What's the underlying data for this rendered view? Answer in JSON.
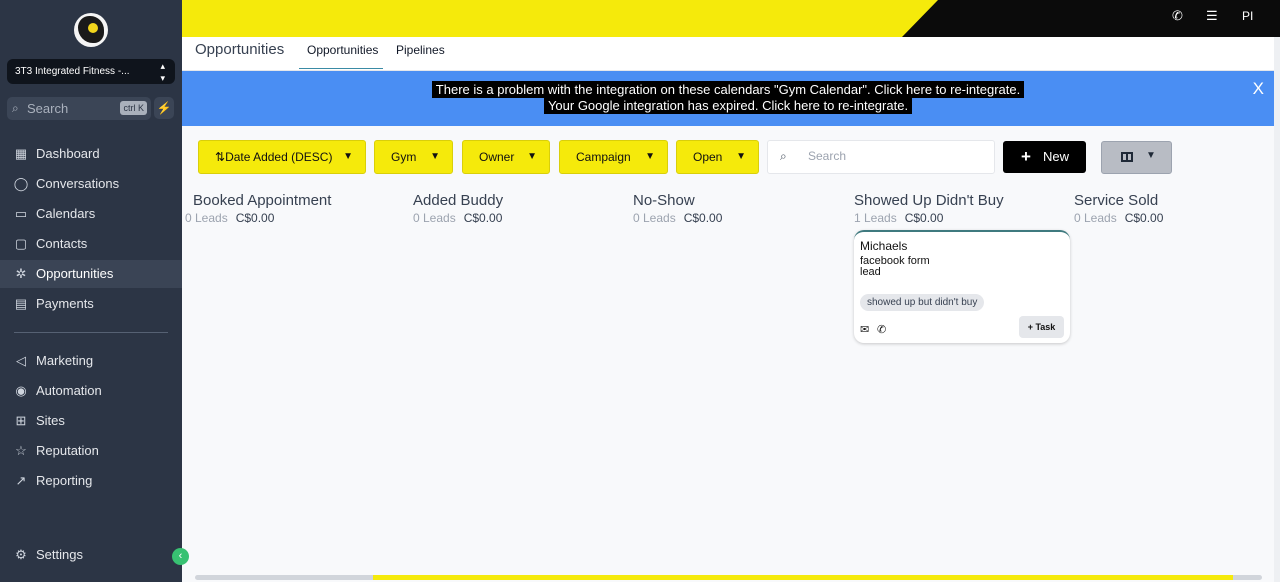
{
  "sidebar": {
    "logo_icon": "gym-logo-icon",
    "account_name": "3T3 Integrated Fitness -...",
    "search": {
      "placeholder": "Search",
      "shortcut": "ctrl K"
    },
    "nav": [
      {
        "label": "Dashboard",
        "icon": "dashboard-icon"
      },
      {
        "label": "Conversations",
        "icon": "chat-icon"
      },
      {
        "label": "Calendars",
        "icon": "calendar-icon"
      },
      {
        "label": "Contacts",
        "icon": "contacts-icon"
      },
      {
        "label": "Opportunities",
        "icon": "opportunities-icon",
        "active": true
      },
      {
        "label": "Payments",
        "icon": "payments-icon"
      }
    ],
    "nav2": [
      {
        "label": "Marketing",
        "icon": "marketing-icon"
      },
      {
        "label": "Automation",
        "icon": "automation-icon"
      },
      {
        "label": "Sites",
        "icon": "sites-icon"
      },
      {
        "label": "Reputation",
        "icon": "star-icon"
      },
      {
        "label": "Reporting",
        "icon": "reporting-icon"
      }
    ],
    "settings_label": "Settings"
  },
  "topbar": {
    "user_initials": "PI",
    "accent": "#f5ea0b"
  },
  "header": {
    "title": "Opportunities",
    "tabs": [
      {
        "label": "Opportunities",
        "active": true
      },
      {
        "label": "Pipelines"
      }
    ]
  },
  "alert": {
    "line1": "There is a problem with the integration on these calendars \"Gym Calendar\". Click here to re-integrate.",
    "line2": "Your Google integration has expired. Click here to re-integrate.",
    "close": "X",
    "color": "#4a8ef3"
  },
  "filters": {
    "sort": "Date Added (DESC)",
    "pipeline": "Gym",
    "owner": "Owner",
    "campaign": "Campaign",
    "status": "Open",
    "search_placeholder": "Search",
    "new_label": "New"
  },
  "columns": [
    {
      "title": "Booked Appointment",
      "count": "0 Leads",
      "amount": "C$0.00"
    },
    {
      "title": "Added Buddy",
      "count": "0 Leads",
      "amount": "C$0.00"
    },
    {
      "title": "No-Show",
      "count": "0 Leads",
      "amount": "C$0.00"
    },
    {
      "title": "Showed Up Didn't Buy",
      "count": "1 Leads",
      "amount": "C$0.00"
    },
    {
      "title": "Service Sold",
      "count": "0 Leads",
      "amount": "C$0.00"
    }
  ],
  "card": {
    "name": "Michaels",
    "source": "facebook form lead",
    "tag": "showed up but didn't buy",
    "task_label": "+ Task"
  }
}
